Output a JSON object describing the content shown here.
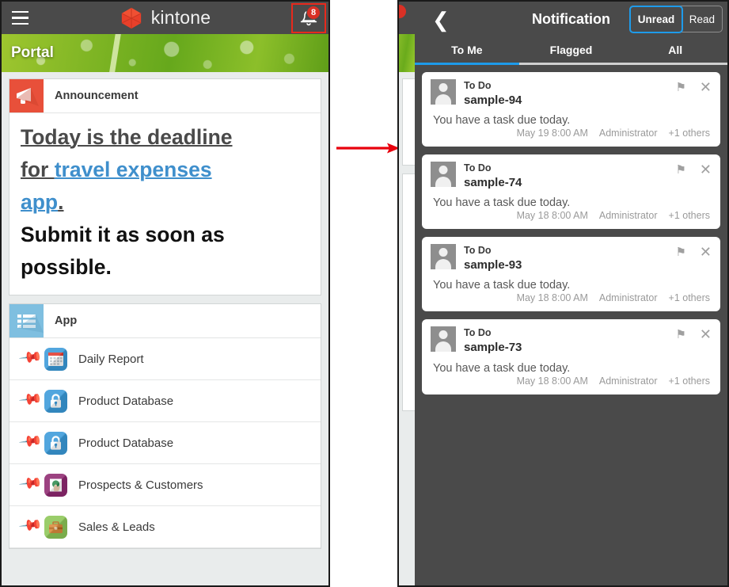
{
  "portal": {
    "topbar": {
      "menu_icon": "hamburger-icon",
      "brand_name": "kintone",
      "brand_logo_icon": "kintone-cube-logo",
      "bell_icon": "bell-icon",
      "notification_count": "8"
    },
    "banner_title": "Portal",
    "announcement": {
      "header_icon": "megaphone-icon",
      "header_label": "Announcement",
      "line1_a": "Today is the deadline",
      "line2_a": "for ",
      "line2_link": "travel expenses",
      "line3_link": "app",
      "line3_period": ".",
      "line4": "Submit it as soon as",
      "line5": "possible."
    },
    "app_section": {
      "header_icon": "list-icon",
      "header_label": "App",
      "items": [
        {
          "label": "Daily Report",
          "icon": "calendar-icon",
          "icon_glyph": "▦",
          "icon_color": "#3a9ad9",
          "pinned": true
        },
        {
          "label": "Product Database",
          "icon": "lock-icon",
          "icon_glyph": "🔒",
          "icon_color": "#3a9ad9",
          "pinned": true
        },
        {
          "label": "Product Database",
          "icon": "lock-icon",
          "icon_glyph": "🔒",
          "icon_color": "#3a9ad9",
          "pinned": false
        },
        {
          "label": "Prospects & Customers",
          "icon": "handshake-icon",
          "icon_glyph": "✋",
          "icon_color": "#8e2870",
          "pinned": false
        },
        {
          "label": "Sales & Leads",
          "icon": "briefcase-icon",
          "icon_glyph": "💼",
          "icon_color": "#8cc656",
          "pinned": false
        }
      ]
    }
  },
  "arrow": {
    "name": "flow-arrow",
    "color": "#e8000d"
  },
  "notification": {
    "back_icon": "back-chevron-icon",
    "title": "Notification",
    "toggle": {
      "unread_label": "Unread",
      "read_label": "Read",
      "selected": "Unread",
      "accent": "#1e9bea"
    },
    "tabs": [
      {
        "label": "To Me",
        "active": true
      },
      {
        "label": "Flagged",
        "active": false
      },
      {
        "label": "All",
        "active": false
      }
    ],
    "cards": [
      {
        "category": "To Do",
        "subject": "sample-94",
        "message": "You have a task due today.",
        "time": "May 19 8:00 AM",
        "author": "Administrator",
        "others": "+1 others",
        "flag_icon": "flag-icon",
        "close_icon": "close-icon",
        "avatar_icon": "user-avatar-icon"
      },
      {
        "category": "To Do",
        "subject": "sample-74",
        "message": "You have a task due today.",
        "time": "May 18 8:00 AM",
        "author": "Administrator",
        "others": "+1 others",
        "flag_icon": "flag-icon",
        "close_icon": "close-icon",
        "avatar_icon": "user-avatar-icon"
      },
      {
        "category": "To Do",
        "subject": "sample-93",
        "message": "You have a task due today.",
        "time": "May 18 8:00 AM",
        "author": "Administrator",
        "others": "+1 others",
        "flag_icon": "flag-icon",
        "close_icon": "close-icon",
        "avatar_icon": "user-avatar-icon"
      },
      {
        "category": "To Do",
        "subject": "sample-73",
        "message": "You have a task due today.",
        "time": "May 18 8:00 AM",
        "author": "Administrator",
        "others": "+1 others",
        "flag_icon": "flag-icon",
        "close_icon": "close-icon",
        "avatar_icon": "user-avatar-icon"
      }
    ]
  }
}
